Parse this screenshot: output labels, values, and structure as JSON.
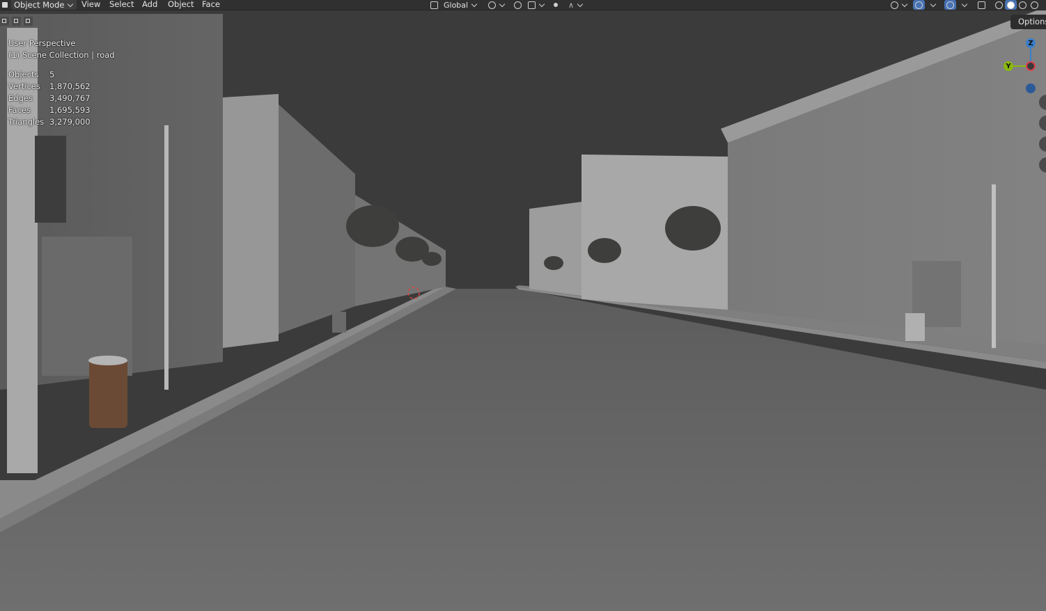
{
  "header": {
    "mode_label": "Object Mode",
    "menus": [
      "View",
      "Select",
      "Add",
      "Object",
      "Face"
    ],
    "transform_orientation": "Global",
    "options_label": "Options"
  },
  "overlay": {
    "perspective": "User Perspective",
    "collection": "(1) Scene Collection | road",
    "stats": [
      {
        "label": "Objects",
        "value": "5"
      },
      {
        "label": "Vertices",
        "value": "1,870,562"
      },
      {
        "label": "Edges",
        "value": "3,490,767"
      },
      {
        "label": "Faces",
        "value": "1,695,593"
      },
      {
        "label": "Triangles",
        "value": "3,279,000"
      }
    ]
  },
  "gizmo": {
    "x": "X",
    "y": "Y",
    "z": "Z"
  },
  "icons": {
    "mode": "object-mode-icon",
    "orientation": "transform-orientation-icon",
    "pivot": "pivot-point-icon",
    "snap": "snap-magnet-icon",
    "proportional": "proportional-edit-icon",
    "visibility": "eye-icon",
    "gizmo_toggle": "gizmo-toggle-icon",
    "overlay_toggle": "overlay-toggle-icon",
    "xray": "xray-icon",
    "shading": [
      "wireframe-shading-icon",
      "solid-shading-icon",
      "material-shading-icon",
      "rendered-shading-icon"
    ]
  },
  "colors": {
    "header_bg": "#303030",
    "sky": "#3a3a3a",
    "road": "#6e6e6e",
    "accent_blue": "#4772b3",
    "axis_x": "#e0414f",
    "axis_y": "#8ab80e",
    "axis_z": "#3a7ec9"
  }
}
